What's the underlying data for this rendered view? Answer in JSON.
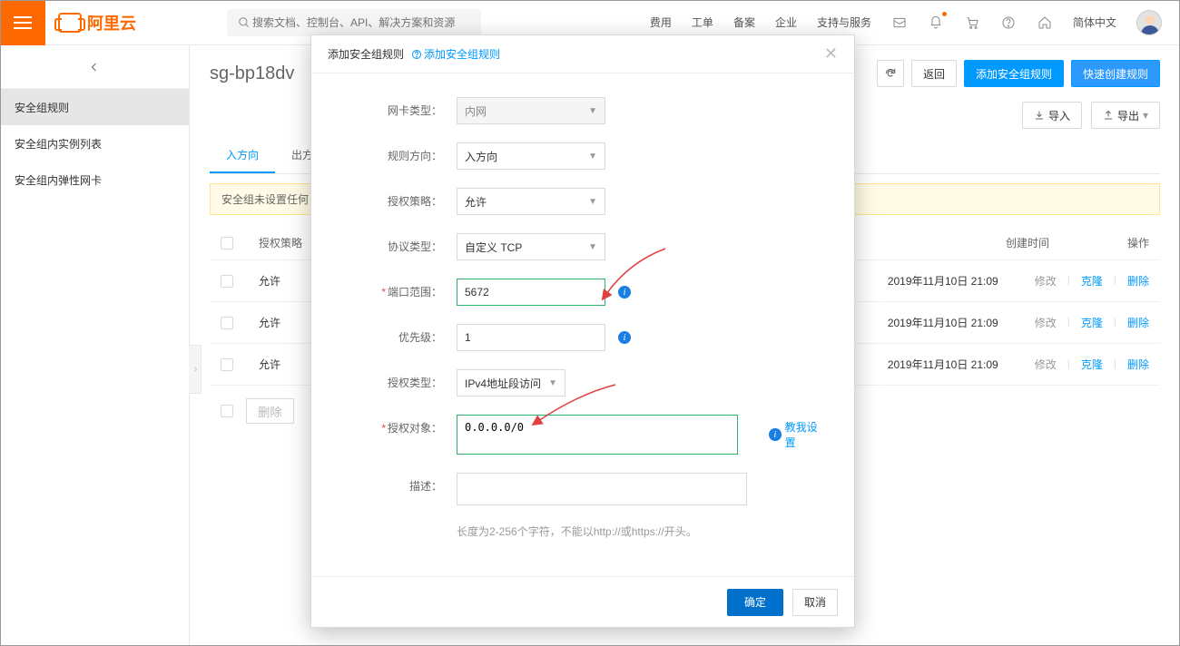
{
  "topnav": {
    "logo_text": "阿里云",
    "search_placeholder": "搜索文档、控制台、API、解决方案和资源",
    "items": [
      "费用",
      "工单",
      "备案",
      "企业",
      "支持与服务"
    ],
    "lang": "简体中文"
  },
  "sidebar": {
    "items": [
      "安全组规则",
      "安全组内实例列表",
      "安全组内弹性网卡"
    ]
  },
  "page": {
    "title": "sg-bp18dv",
    "buttons": {
      "return": "返回",
      "add_rule": "添加安全组规则",
      "quick_create": "快速创建规则"
    },
    "io": {
      "import": "导入",
      "export": "导出"
    },
    "tabs": {
      "in": "入方向",
      "out": "出方"
    },
    "warning": "安全组未设置任何",
    "table": {
      "header_auth": "授权策略",
      "header_created": "创建时间",
      "header_ops": "操作",
      "rows": [
        {
          "auth": "允许",
          "date": "2019年11月10日 21:09"
        },
        {
          "auth": "允许",
          "date": "2019年11月10日 21:09"
        },
        {
          "auth": "允许",
          "date": "2019年11月10日 21:09"
        }
      ],
      "ops": {
        "modify": "修改",
        "clone": "克隆",
        "delete": "删除"
      },
      "footer_delete": "删除"
    }
  },
  "modal": {
    "title": "添加安全组规则",
    "help_link": "添加安全组规则",
    "labels": {
      "nic_type": "网卡类型：",
      "direction": "规则方向：",
      "auth_policy": "授权策略：",
      "protocol": "协议类型：",
      "port_range": "端口范围：",
      "priority": "优先级：",
      "auth_type": "授权类型：",
      "auth_object": "授权对象：",
      "description": "描述："
    },
    "values": {
      "nic_type": "内网",
      "direction": "入方向",
      "auth_policy": "允许",
      "protocol": "自定义 TCP",
      "port_range": "5672",
      "priority": "1",
      "auth_type": "IPv4地址段访问",
      "auth_object": "0.0.0.0/0"
    },
    "teach_me": "教我设置",
    "desc_hint": "长度为2-256个字符，不能以http://或https://开头。",
    "ok": "确定",
    "cancel": "取消"
  }
}
